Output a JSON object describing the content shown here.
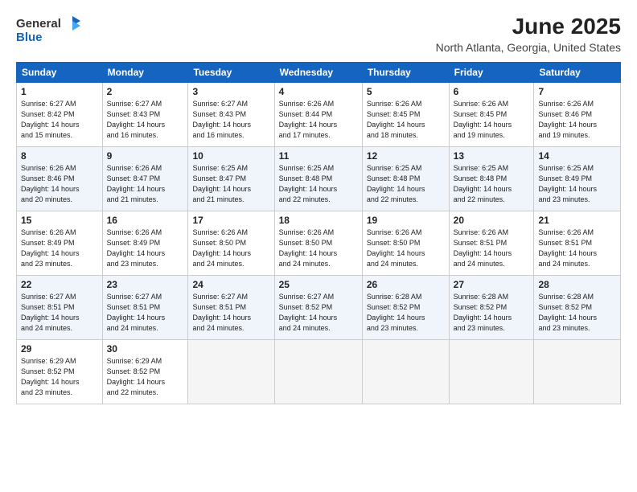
{
  "header": {
    "logo": {
      "general": "General",
      "blue": "Blue"
    },
    "title": "June 2025",
    "location": "North Atlanta, Georgia, United States"
  },
  "columns": [
    "Sunday",
    "Monday",
    "Tuesday",
    "Wednesday",
    "Thursday",
    "Friday",
    "Saturday"
  ],
  "weeks": [
    [
      {
        "day": "1",
        "sunrise": "6:27 AM",
        "sunset": "8:42 PM",
        "daylight": "14 hours and 15 minutes."
      },
      {
        "day": "2",
        "sunrise": "6:27 AM",
        "sunset": "8:43 PM",
        "daylight": "14 hours and 16 minutes."
      },
      {
        "day": "3",
        "sunrise": "6:27 AM",
        "sunset": "8:43 PM",
        "daylight": "14 hours and 16 minutes."
      },
      {
        "day": "4",
        "sunrise": "6:26 AM",
        "sunset": "8:44 PM",
        "daylight": "14 hours and 17 minutes."
      },
      {
        "day": "5",
        "sunrise": "6:26 AM",
        "sunset": "8:45 PM",
        "daylight": "14 hours and 18 minutes."
      },
      {
        "day": "6",
        "sunrise": "6:26 AM",
        "sunset": "8:45 PM",
        "daylight": "14 hours and 19 minutes."
      },
      {
        "day": "7",
        "sunrise": "6:26 AM",
        "sunset": "8:46 PM",
        "daylight": "14 hours and 19 minutes."
      }
    ],
    [
      {
        "day": "8",
        "sunrise": "6:26 AM",
        "sunset": "8:46 PM",
        "daylight": "14 hours and 20 minutes."
      },
      {
        "day": "9",
        "sunrise": "6:26 AM",
        "sunset": "8:47 PM",
        "daylight": "14 hours and 21 minutes."
      },
      {
        "day": "10",
        "sunrise": "6:25 AM",
        "sunset": "8:47 PM",
        "daylight": "14 hours and 21 minutes."
      },
      {
        "day": "11",
        "sunrise": "6:25 AM",
        "sunset": "8:48 PM",
        "daylight": "14 hours and 22 minutes."
      },
      {
        "day": "12",
        "sunrise": "6:25 AM",
        "sunset": "8:48 PM",
        "daylight": "14 hours and 22 minutes."
      },
      {
        "day": "13",
        "sunrise": "6:25 AM",
        "sunset": "8:48 PM",
        "daylight": "14 hours and 22 minutes."
      },
      {
        "day": "14",
        "sunrise": "6:25 AM",
        "sunset": "8:49 PM",
        "daylight": "14 hours and 23 minutes."
      }
    ],
    [
      {
        "day": "15",
        "sunrise": "6:26 AM",
        "sunset": "8:49 PM",
        "daylight": "14 hours and 23 minutes."
      },
      {
        "day": "16",
        "sunrise": "6:26 AM",
        "sunset": "8:49 PM",
        "daylight": "14 hours and 23 minutes."
      },
      {
        "day": "17",
        "sunrise": "6:26 AM",
        "sunset": "8:50 PM",
        "daylight": "14 hours and 24 minutes."
      },
      {
        "day": "18",
        "sunrise": "6:26 AM",
        "sunset": "8:50 PM",
        "daylight": "14 hours and 24 minutes."
      },
      {
        "day": "19",
        "sunrise": "6:26 AM",
        "sunset": "8:50 PM",
        "daylight": "14 hours and 24 minutes."
      },
      {
        "day": "20",
        "sunrise": "6:26 AM",
        "sunset": "8:51 PM",
        "daylight": "14 hours and 24 minutes."
      },
      {
        "day": "21",
        "sunrise": "6:26 AM",
        "sunset": "8:51 PM",
        "daylight": "14 hours and 24 minutes."
      }
    ],
    [
      {
        "day": "22",
        "sunrise": "6:27 AM",
        "sunset": "8:51 PM",
        "daylight": "14 hours and 24 minutes."
      },
      {
        "day": "23",
        "sunrise": "6:27 AM",
        "sunset": "8:51 PM",
        "daylight": "14 hours and 24 minutes."
      },
      {
        "day": "24",
        "sunrise": "6:27 AM",
        "sunset": "8:51 PM",
        "daylight": "14 hours and 24 minutes."
      },
      {
        "day": "25",
        "sunrise": "6:27 AM",
        "sunset": "8:52 PM",
        "daylight": "14 hours and 24 minutes."
      },
      {
        "day": "26",
        "sunrise": "6:28 AM",
        "sunset": "8:52 PM",
        "daylight": "14 hours and 23 minutes."
      },
      {
        "day": "27",
        "sunrise": "6:28 AM",
        "sunset": "8:52 PM",
        "daylight": "14 hours and 23 minutes."
      },
      {
        "day": "28",
        "sunrise": "6:28 AM",
        "sunset": "8:52 PM",
        "daylight": "14 hours and 23 minutes."
      }
    ],
    [
      {
        "day": "29",
        "sunrise": "6:29 AM",
        "sunset": "8:52 PM",
        "daylight": "14 hours and 23 minutes."
      },
      {
        "day": "30",
        "sunrise": "6:29 AM",
        "sunset": "8:52 PM",
        "daylight": "14 hours and 22 minutes."
      },
      {
        "day": "",
        "sunrise": "",
        "sunset": "",
        "daylight": ""
      },
      {
        "day": "",
        "sunrise": "",
        "sunset": "",
        "daylight": ""
      },
      {
        "day": "",
        "sunrise": "",
        "sunset": "",
        "daylight": ""
      },
      {
        "day": "",
        "sunrise": "",
        "sunset": "",
        "daylight": ""
      },
      {
        "day": "",
        "sunrise": "",
        "sunset": "",
        "daylight": ""
      }
    ]
  ],
  "labels": {
    "sunrise": "Sunrise:",
    "sunset": "Sunset:",
    "daylight": "Daylight:"
  }
}
